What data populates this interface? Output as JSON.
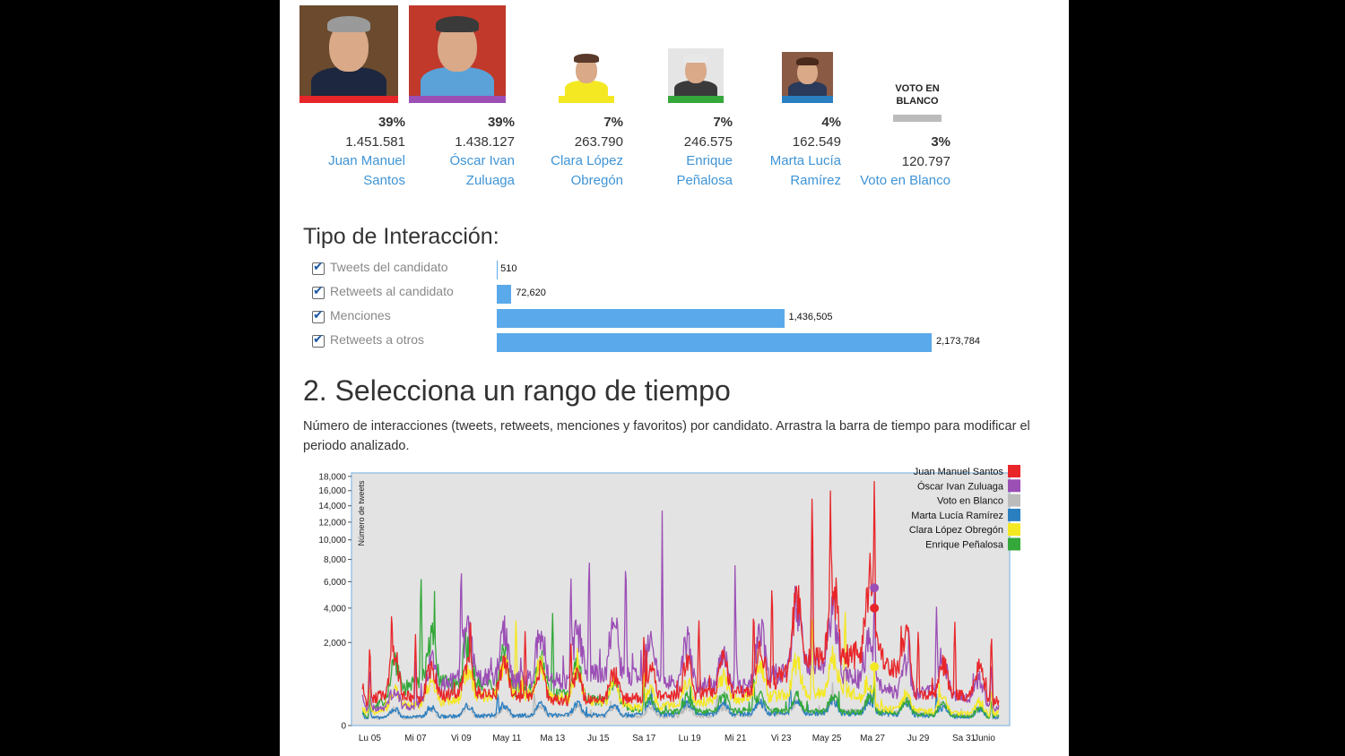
{
  "candidates": [
    {
      "pct": "39%",
      "votes": "1.451.581",
      "name_line1": "Juan Manuel",
      "name_line2": "Santos",
      "color": "#e8262a",
      "photo": "photo-santos"
    },
    {
      "pct": "39%",
      "votes": "1.438.127",
      "name_line1": "Óscar Ivan",
      "name_line2": "Zuluaga",
      "color": "#9b4fb5",
      "photo": "photo-zuluaga"
    },
    {
      "pct": "7%",
      "votes": "263.790",
      "name_line1": "Clara López",
      "name_line2": "Obregón",
      "color": "#f4e823",
      "photo": "photo-lopez"
    },
    {
      "pct": "7%",
      "votes": "246.575",
      "name_line1": "Enrique",
      "name_line2": "Peñalosa",
      "color": "#34a83a",
      "photo": "photo-penalosa"
    },
    {
      "pct": "4%",
      "votes": "162.549",
      "name_line1": "Marta Lucía",
      "name_line2": "Ramírez",
      "color": "#2a7fc1",
      "photo": "photo-ramirez"
    }
  ],
  "blanco": {
    "title_line1": "VOTO EN",
    "title_line2": "BLANCO",
    "pct": "3%",
    "votes": "120.797",
    "name": "Voto en Blanco",
    "color": "#bbbbbb"
  },
  "interaction": {
    "title": "Tipo de Interacción:",
    "rows": [
      {
        "label": "Tweets del candidato",
        "value": 510,
        "value_label": "510"
      },
      {
        "label": "Retweets al candidato",
        "value": 72620,
        "value_label": "72,620"
      },
      {
        "label": "Menciones",
        "value": 1436505,
        "value_label": "1,436,505"
      },
      {
        "label": "Retweets a otros",
        "value": 2173784,
        "value_label": "2,173,784"
      }
    ],
    "bar_color": "#5aa9ea"
  },
  "section2": {
    "title": "2. Selecciona un rango de tiempo",
    "description": "Número de interacciones (tweets, retweets, menciones y favoritos) por candidato. Arrastra la barra de tiempo para modificar el periodo analizado."
  },
  "chart_data": {
    "type": "line",
    "ylabel": "Número de tweets",
    "y_ticks": [
      0,
      2000,
      4000,
      6000,
      8000,
      10000,
      12000,
      14000,
      16000,
      18000
    ],
    "y_tick_labels": [
      "0",
      "2,000",
      "4,000",
      "6,000",
      "8,000",
      "10,000",
      "12,000",
      "14,000",
      "16,000",
      "18,000"
    ],
    "y_scale": "sqrt",
    "x_tick_labels": [
      "Lu 05",
      "Mi 07",
      "Vi 09",
      "May 11",
      "Ma 13",
      "Ju 15",
      "Sa 17",
      "Lu 19",
      "Mi 21",
      "Vi 23",
      "May 25",
      "Ma 27",
      "Ju 29",
      "Sa 31",
      "Junio"
    ],
    "grid": false,
    "legend_position": "top-right",
    "series": [
      {
        "name": "Juan Manuel Santos",
        "color": "#e8262a"
      },
      {
        "name": "Óscar Ivan Zuluaga",
        "color": "#9b4fb5"
      },
      {
        "name": "Voto en Blanco",
        "color": "#bbbbbb"
      },
      {
        "name": "Marta Lucía Ramírez",
        "color": "#2a7fc1"
      },
      {
        "name": "Clara López Obregón",
        "color": "#f4e823"
      },
      {
        "name": "Enrique Peñalosa",
        "color": "#34a83a"
      }
    ],
    "series_data": {
      "Juan Manuel Santos": [
        [
          1,
          2000
        ],
        [
          2.2,
          4200
        ],
        [
          3.5,
          2400
        ],
        [
          6.5,
          3800
        ],
        [
          9.5,
          2800
        ],
        [
          12,
          2100
        ],
        [
          16,
          2600
        ],
        [
          19,
          3400
        ],
        [
          22,
          4200
        ],
        [
          23,
          6200
        ],
        [
          25.2,
          16500
        ],
        [
          26.2,
          16500
        ],
        [
          28.6,
          18500
        ],
        [
          31,
          2800
        ],
        [
          33,
          3200
        ],
        [
          35,
          2600
        ]
      ],
      "Óscar Ivan Zuluaga": [
        [
          1,
          1000
        ],
        [
          3.5,
          1200
        ],
        [
          6,
          8000
        ],
        [
          12,
          6800
        ],
        [
          13,
          9000
        ],
        [
          15,
          8600
        ],
        [
          17,
          6500
        ],
        [
          21,
          4700
        ],
        [
          25.2,
          13000
        ],
        [
          28.6,
          5500
        ],
        [
          30.5,
          3000
        ],
        [
          32,
          4200
        ],
        [
          35,
          1200
        ]
      ],
      "Voto en Blanco": [
        [
          1,
          200
        ],
        [
          10,
          300
        ],
        [
          20,
          300
        ],
        [
          28.6,
          700
        ],
        [
          35,
          200
        ]
      ],
      "Marta Lucía Ramírez": [
        [
          1,
          200
        ],
        [
          8,
          350
        ],
        [
          16,
          400
        ],
        [
          24,
          500
        ],
        [
          28.6,
          500
        ],
        [
          32,
          300
        ],
        [
          35,
          200
        ]
      ],
      "Clara López Obregón": [
        [
          1,
          500
        ],
        [
          9,
          3600
        ],
        [
          16,
          1000
        ],
        [
          25.2,
          3600
        ],
        [
          27,
          4200
        ],
        [
          28.6,
          1000
        ],
        [
          35,
          400
        ]
      ],
      "Enrique Peñalosa": [
        [
          1,
          300
        ],
        [
          3.8,
          7000
        ],
        [
          11,
          3700
        ],
        [
          16,
          600
        ],
        [
          22,
          800
        ],
        [
          28.6,
          600
        ],
        [
          35,
          200
        ]
      ]
    },
    "markers": [
      {
        "series": "Óscar Ivan Zuluaga",
        "x": 28.6,
        "y": 5500
      },
      {
        "series": "Juan Manuel Santos",
        "x": 28.6,
        "y": 4000
      },
      {
        "series": "Clara López Obregón",
        "x": 28.6,
        "y": 1000
      }
    ],
    "x_range": [
      0,
      36
    ]
  }
}
